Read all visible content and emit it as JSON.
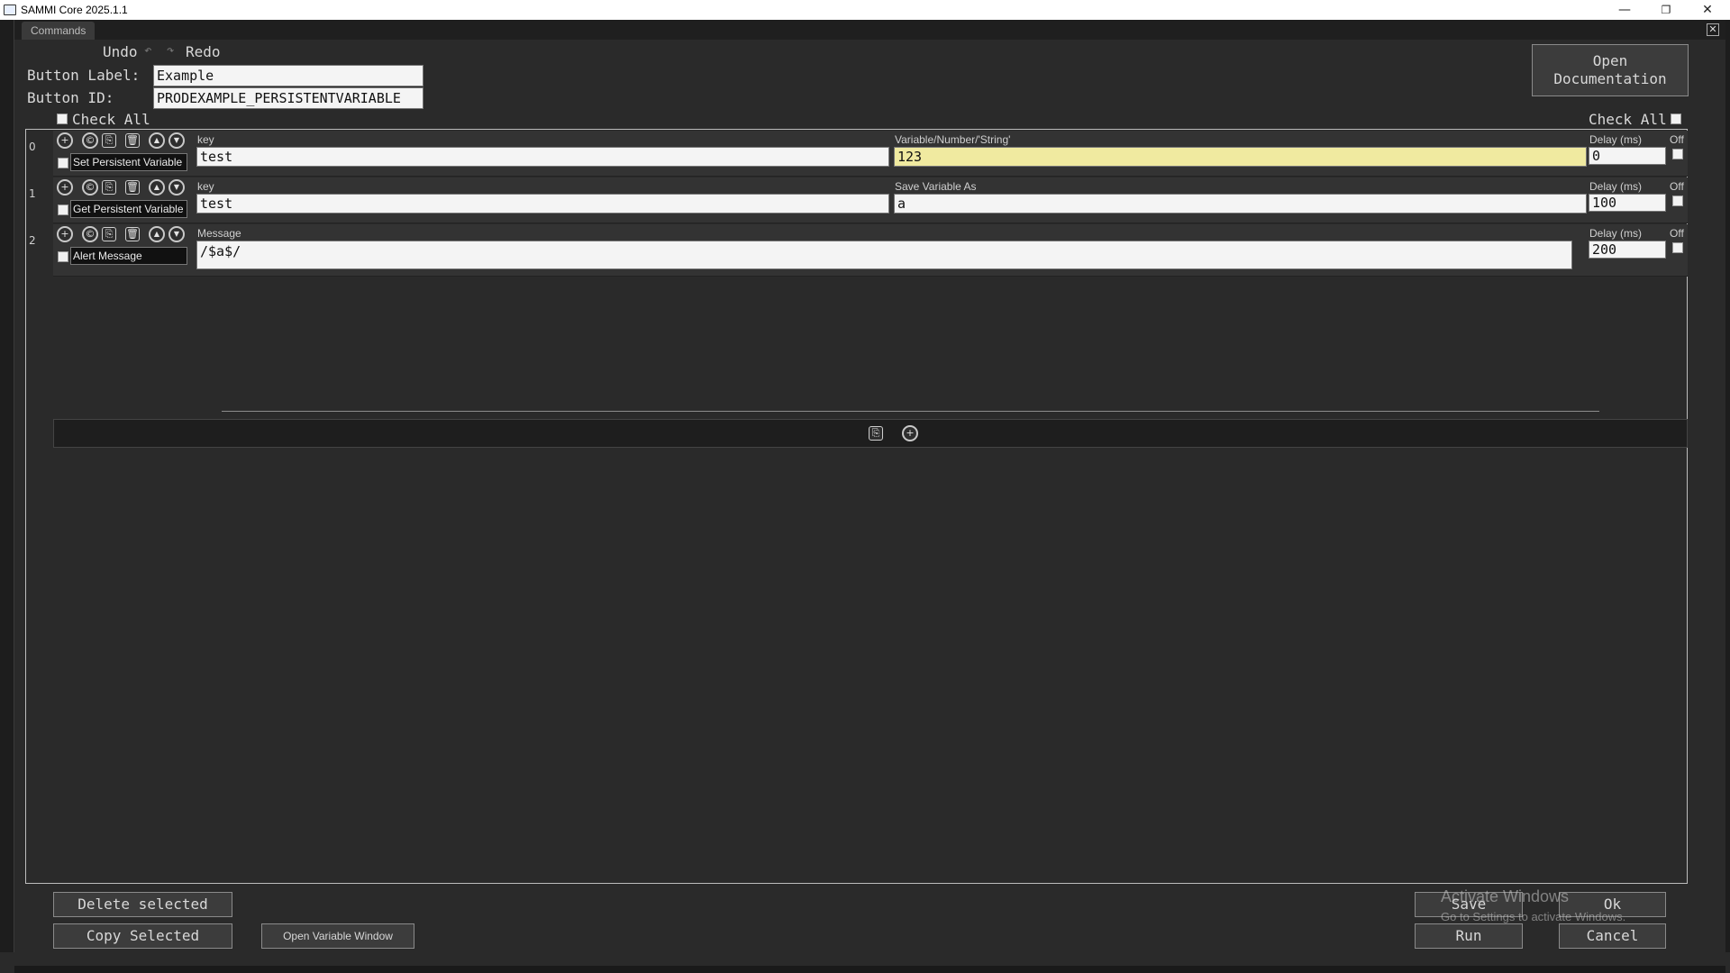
{
  "window": {
    "title": "SAMMI Core 2025.1.1",
    "minimize": "—",
    "restore": "❐",
    "close": "✕"
  },
  "tabs": {
    "commands": "Commands",
    "close_label": "✕"
  },
  "toolbar": {
    "undo_label": "Undo",
    "redo_label": "Redo",
    "undo_icon": "↶",
    "redo_icon": "↷"
  },
  "button": {
    "label_caption": "Button Label:",
    "label_value": "Example",
    "id_caption": "Button ID:",
    "id_value": "PRODEXAMPLE_PERSISTENTVARIABLE"
  },
  "open_documentation": {
    "line1": "Open",
    "line2": "Documentation"
  },
  "check_all_left": "Check All",
  "check_all_right": "Check All",
  "row_icons": {
    "add": "+",
    "copy": "©",
    "paste": "⎘",
    "delete": "🗑",
    "up": "▲",
    "down": "▼"
  },
  "commands": [
    {
      "index": "0",
      "name": "Set Persistent Variable",
      "field1_label": "key",
      "field1_value": "test",
      "field2_label": "Variable/Number/'String'",
      "field2_value": "123",
      "delay_label": "Delay (ms)",
      "delay_value": "0",
      "off_label": "Off"
    },
    {
      "index": "1",
      "name": "Get Persistent Variable",
      "field1_label": "key",
      "field1_value": "test",
      "field2_label": "Save Variable As",
      "field2_value": "a",
      "delay_label": "Delay (ms)",
      "delay_value": "100",
      "off_label": "Off"
    },
    {
      "index": "2",
      "name": "Alert Message",
      "field1_label": "Message",
      "field1_value": "/$a$/",
      "delay_label": "Delay (ms)",
      "delay_value": "200",
      "off_label": "Off"
    }
  ],
  "footer": {
    "delete_selected": "Delete selected",
    "copy_selected": "Copy Selected",
    "open_variable_window": "Open Variable Window",
    "save": "Save",
    "ok": "Ok",
    "run": "Run",
    "cancel": "Cancel"
  },
  "activation_watermark": {
    "line1": "Activate Windows",
    "line2": "Go to Settings to activate Windows."
  },
  "colors": {
    "highlight_field": "#f0eaa0",
    "background": "#2a2a2a"
  }
}
